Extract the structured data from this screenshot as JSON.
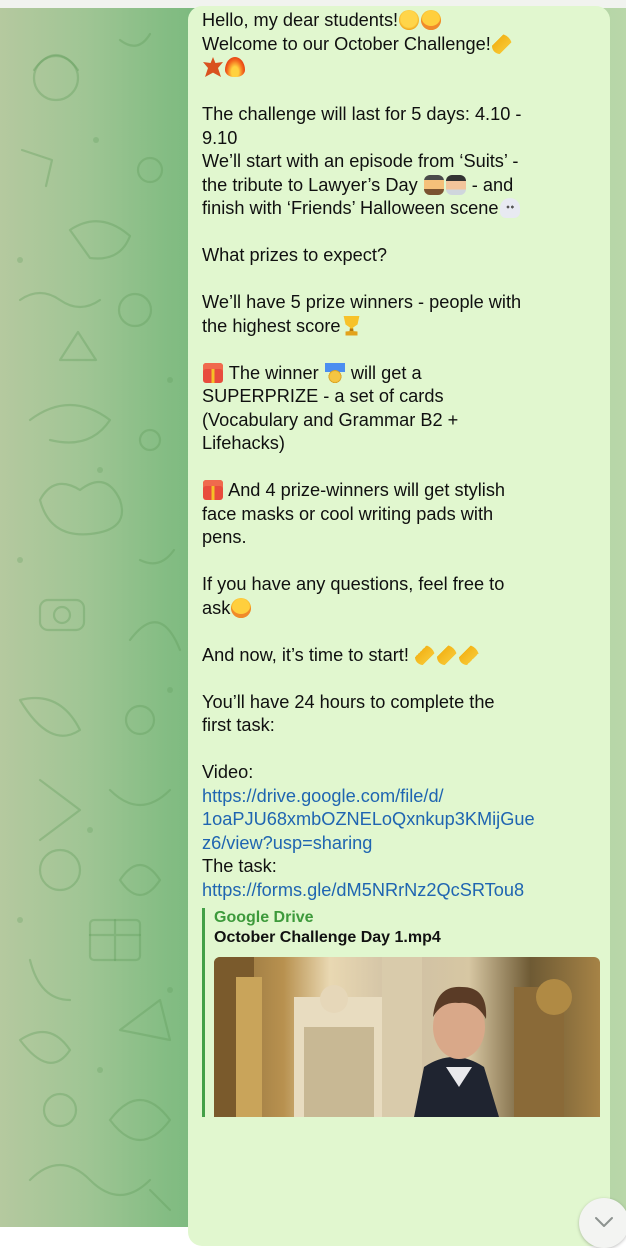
{
  "chat": {
    "message": {
      "greeting": "Hello, my dear students!",
      "welcome": "Welcome to our October Challenge!",
      "duration_line1": "The challenge will last for 5 days: 4.10 -",
      "duration_line2": "9.10",
      "episode_line1": "We’ll start with an episode from ‘Suits’ -",
      "episode_line2a": "the tribute to Lawyer’s Day",
      "episode_line2b": "- and",
      "episode_line3": "finish with ‘Friends’ Halloween scene",
      "prizes_question": "What prizes to expect?",
      "winners_line1": "We’ll have 5 prize winners - people with",
      "winners_line2": "the highest score",
      "superprize_line1a": "The winner",
      "superprize_line1b": "will get a",
      "superprize_line2": "SUPERPRIZE - a set of cards",
      "superprize_line3": "(Vocabulary and Grammar B2 +",
      "superprize_line4": "Lifehacks)",
      "other_prizes_line1": "And 4 prize-winners will get stylish",
      "other_prizes_line2": "face masks or cool writing pads with",
      "other_prizes_line3": "pens.",
      "questions_line1": "If you have any questions, feel free to",
      "questions_line2": "ask",
      "start_line": "And now, it’s time to start!",
      "hours_line1": "You’ll have 24 hours to complete the",
      "hours_line2": "first task:",
      "video_label": "Video:",
      "video_link_line1": "https://drive.google.com/file/d/",
      "video_link_line2": "1oaPJU68xmbOZNELoQxnkup3KMijGue",
      "video_link_line3": "z6/view?usp=sharing",
      "task_label": "The task:",
      "task_link": "https://forms.gle/dM5NRrNz2QcSRTou8"
    },
    "link_preview": {
      "source": "Google Drive",
      "title": "October Challenge Day 1.mp4"
    }
  },
  "icons": {
    "scroll_down": "chevron-down-icon",
    "background_pattern": "doodle-pattern"
  },
  "colors": {
    "bubble": "#e1f7cf",
    "link": "#1f65b1",
    "preview_accent": "#43a047",
    "chat_background": "#85bd84"
  }
}
